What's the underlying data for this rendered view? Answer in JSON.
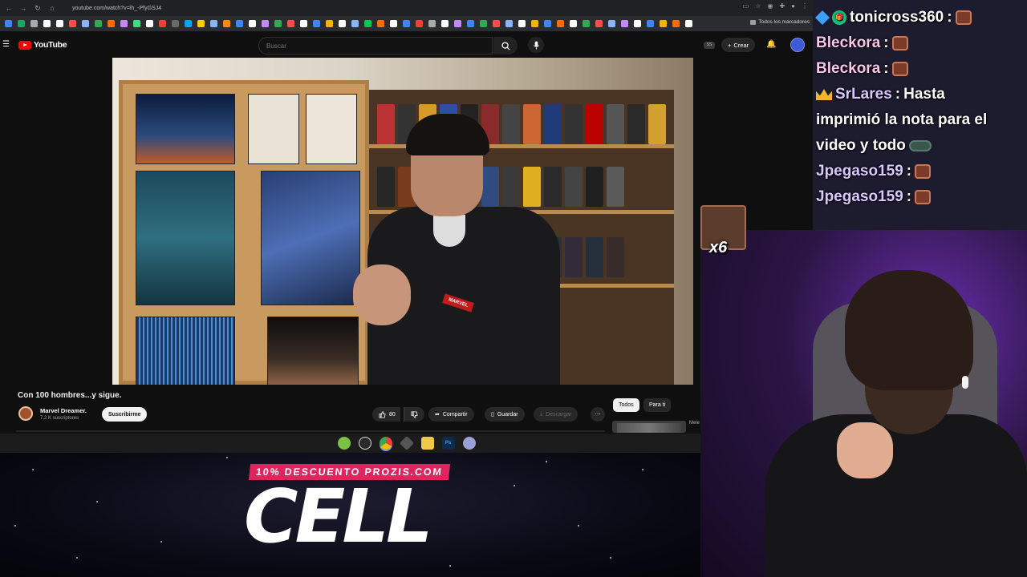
{
  "browser": {
    "url": "youtube.com/watch?v=ih_-PfyGSJ4",
    "bookmarks_all_label": "Todos los marcadores",
    "bookmark_colors": [
      "#4285f4",
      "#1da462",
      "#aaaaaa",
      "#ffffff",
      "#ffffff",
      "#ff4d4d",
      "#8ab4f8",
      "#34a853",
      "#ff6d00",
      "#c58af9",
      "#3ddc84",
      "#ffffff",
      "#e94235",
      "#6a6a6a",
      "#00a6ed",
      "#ffcc00",
      "#8ab4f8",
      "#ff8a00",
      "#4285f4",
      "#ffffff",
      "#c58af9",
      "#34a853",
      "#ff4d4d",
      "#ffffff",
      "#4285f4",
      "#f4b400",
      "#ffffff",
      "#8ab4f8",
      "#00c853",
      "#ff6d00",
      "#ffffff",
      "#4285f4",
      "#ea4335",
      "#aaaaaa",
      "#ffffff",
      "#c58af9",
      "#4285f4",
      "#34a853",
      "#ff4d4d",
      "#8ab4f8",
      "#ffffff",
      "#f4b400",
      "#4285f4",
      "#ff6d00",
      "#ffffff",
      "#34a853",
      "#ff4d4d",
      "#8ab4f8",
      "#c58af9",
      "#ffffff",
      "#4285f4",
      "#f4b400",
      "#ff6d00",
      "#ffffff"
    ]
  },
  "youtube": {
    "logo_text": "YouTube",
    "search_placeholder": "Buscar",
    "ss_badge": "SS",
    "create_label": "Crear",
    "video": {
      "title": "Con 100 hombres...y sigue.",
      "channel_name": "Marvel Dreamer.",
      "subscribers": "7,2 K suscriptores",
      "subscribe_label": "Suscribirme",
      "likes": "80",
      "share_label": "Compartir",
      "save_label": "Guardar",
      "download_label": "Descargar"
    },
    "chips": {
      "all": "Todos",
      "for_you": "Para ti"
    },
    "recommended_text": "Mele Orid"
  },
  "chat": [
    {
      "user": "tonicross360",
      "sep": ":",
      "message": "",
      "style": "white",
      "badges": [
        "cube-badge",
        "gift-badge"
      ]
    },
    {
      "user": "Bleckora",
      "sep": ":",
      "message": "",
      "style": "pink",
      "badges": []
    },
    {
      "user": "Bleckora",
      "sep": ":",
      "message": "",
      "style": "pink",
      "badges": []
    },
    {
      "user": "SrLares",
      "sep": ":",
      "message_line1": "Hasta",
      "message_line2": "imprimió la nota para el",
      "message_line3": "video y todo",
      "style": "lav",
      "badges": [
        "crown-badge"
      ]
    },
    {
      "user": "Jpegaso159",
      "sep": ":",
      "message": "",
      "style": "lav",
      "badges": []
    },
    {
      "user": "Jpegaso159",
      "sep": ":",
      "message": "",
      "style": "lav",
      "badges": []
    }
  ],
  "emote_popup": {
    "count": "x6"
  },
  "banner": {
    "promo": "10% DESCUENTO PROZIS.COM",
    "headline": "CELL"
  },
  "taskbar": {
    "apps": [
      "android-icon",
      "steam-icon",
      "chrome-icon",
      "obs-icon",
      "files-icon",
      "photoshop-icon",
      "discord-icon"
    ]
  }
}
